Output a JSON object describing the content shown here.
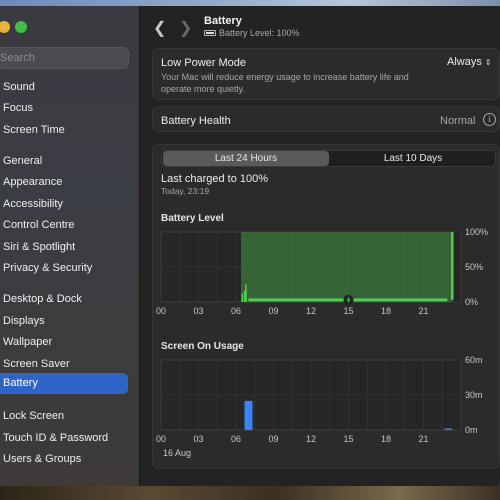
{
  "window": {
    "title": "Battery",
    "subtitle": "Battery Level: 100%"
  },
  "search": {
    "placeholder": "Search"
  },
  "sidebar": {
    "items": [
      {
        "label": "Sound"
      },
      {
        "label": "Focus"
      },
      {
        "label": "Screen Time"
      },
      {
        "label": "General"
      },
      {
        "label": "Appearance"
      },
      {
        "label": "Accessibility"
      },
      {
        "label": "Control Centre"
      },
      {
        "label": "Siri & Spotlight"
      },
      {
        "label": "Privacy & Security"
      },
      {
        "label": "Desktop & Dock"
      },
      {
        "label": "Displays"
      },
      {
        "label": "Wallpaper"
      },
      {
        "label": "Screen Saver"
      },
      {
        "label": "Battery",
        "selected": true
      },
      {
        "label": "Lock Screen"
      },
      {
        "label": "Touch ID & Password"
      },
      {
        "label": "Users & Groups"
      }
    ]
  },
  "low_power": {
    "title": "Low Power Mode",
    "description": "Your Mac will reduce energy usage to increase battery life and operate more quietly.",
    "value": "Always"
  },
  "health": {
    "title": "Battery Health",
    "value": "Normal"
  },
  "tabs": {
    "first": "Last 24 Hours",
    "second": "Last 10 Days",
    "selected": "Last 24 Hours"
  },
  "last_charged": {
    "title": "Last charged to 100%",
    "time": "Today, 23:19"
  },
  "battery_level": {
    "title": "Battery Level",
    "y_ticks": [
      "100%",
      "50%",
      "0%"
    ],
    "x_ticks": [
      "00",
      "03",
      "06",
      "09",
      "12",
      "15",
      "18",
      "21"
    ],
    "colors": {
      "level": "#4fcf52",
      "charging_fill": "#3a6e3a",
      "grid": "#3c3c3c"
    }
  },
  "screen_usage": {
    "title": "Screen On Usage",
    "y_ticks": [
      "60m",
      "30m",
      "0m"
    ],
    "x_ticks": [
      "00",
      "03",
      "06",
      "09",
      "12",
      "15",
      "18",
      "21"
    ],
    "date_label": "16 Aug",
    "colors": {
      "bar": "#3b82f6"
    }
  },
  "chart_data": [
    {
      "type": "area",
      "title": "Battery Level",
      "x_unit": "hour of day",
      "ylim": [
        0,
        100
      ],
      "y_unit": "%",
      "points": [
        {
          "x": 6.5,
          "y": 12
        },
        {
          "x": 6.7,
          "y": 16
        },
        {
          "x": 6.8,
          "y": 25
        },
        {
          "x": 7.0,
          "y": 3
        },
        {
          "x": 22.9,
          "y": 3
        },
        {
          "x": 23.3,
          "y": 100
        }
      ],
      "charging_ranges": [
        [
          6.4,
          23.3
        ]
      ]
    },
    {
      "type": "bar",
      "title": "Screen On Usage",
      "x_unit": "hour of day",
      "ylim": [
        0,
        60
      ],
      "y_unit": "minutes",
      "bars": [
        {
          "x": 7,
          "value": 25
        },
        {
          "x": 23,
          "value": 1
        }
      ]
    }
  ]
}
